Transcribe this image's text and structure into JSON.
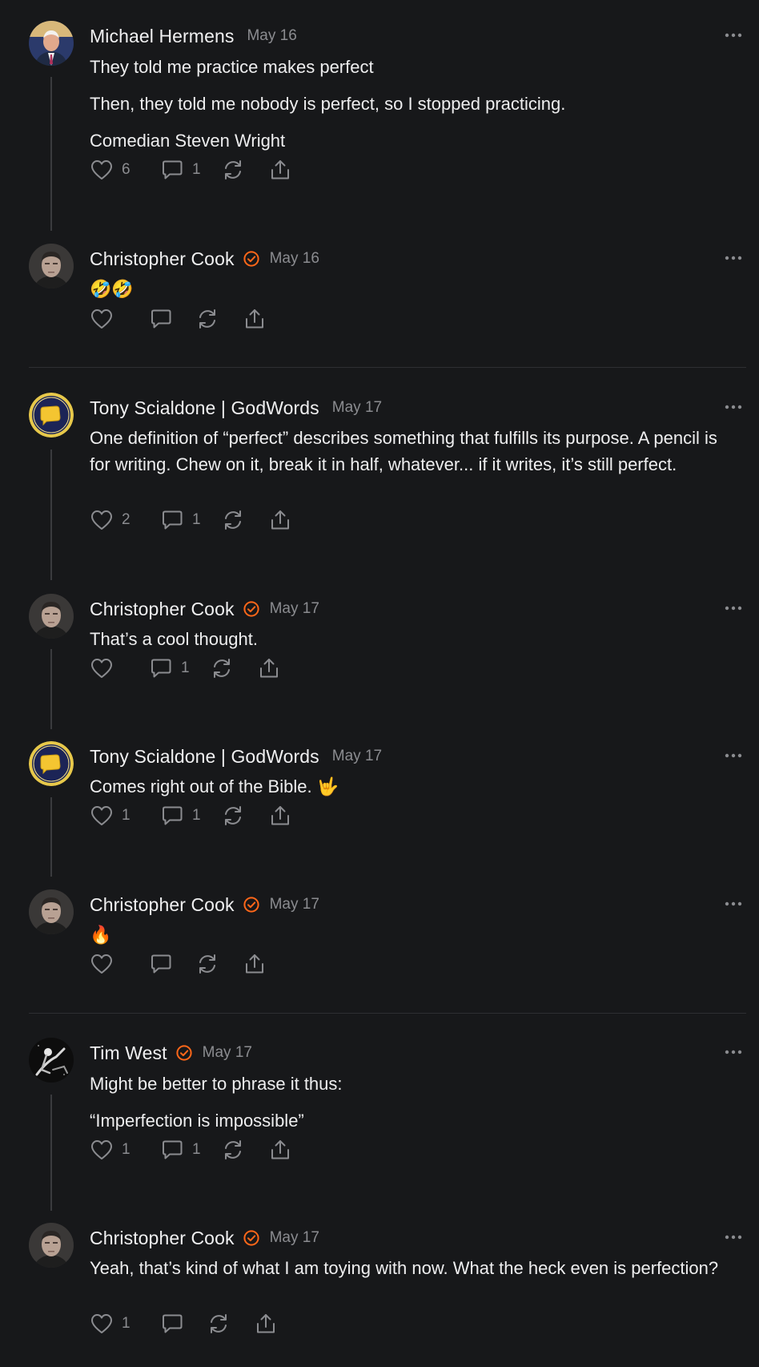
{
  "comments": [
    {
      "author": "Michael Hermens",
      "verified": false,
      "date": "May 16",
      "avatar": "avatar-michael-hermens",
      "paragraphs": [
        "They told me practice makes perfect",
        "Then, they told me nobody is perfect, so I stopped practicing.",
        "Comedian Steven Wright"
      ],
      "likes": "6",
      "replies": "1"
    },
    {
      "author": "Christopher Cook",
      "verified": true,
      "date": "May 16",
      "avatar": "avatar-christopher-cook",
      "paragraphs": [
        "🤣🤣"
      ],
      "likes": "",
      "replies": ""
    },
    {
      "author": "Tony Scialdone | GodWords",
      "verified": false,
      "date": "May 17",
      "avatar": "avatar-godwords",
      "paragraphs": [
        "One definition of “perfect” describes something that fulfills its purpose. A pencil is for writing. Chew on it, break it in half, whatever... if it writes, it’s still perfect."
      ],
      "likes": "2",
      "replies": "1"
    },
    {
      "author": "Christopher Cook",
      "verified": true,
      "date": "May 17",
      "avatar": "avatar-christopher-cook",
      "paragraphs": [
        "That’s a cool thought."
      ],
      "likes": "",
      "replies": "1"
    },
    {
      "author": "Tony Scialdone | GodWords",
      "verified": false,
      "date": "May 17",
      "avatar": "avatar-godwords",
      "paragraphs": [
        "Comes right out of the Bible. 🤟"
      ],
      "likes": "1",
      "replies": "1"
    },
    {
      "author": "Christopher Cook",
      "verified": true,
      "date": "May 17",
      "avatar": "avatar-christopher-cook",
      "paragraphs": [
        "🔥"
      ],
      "likes": "",
      "replies": ""
    },
    {
      "author": "Tim West",
      "verified": true,
      "date": "May 17",
      "avatar": "avatar-tim-west",
      "paragraphs": [
        "Might be better to phrase it thus:",
        "“Imperfection is impossible”"
      ],
      "likes": "1",
      "replies": "1"
    },
    {
      "author": "Christopher Cook",
      "verified": true,
      "date": "May 17",
      "avatar": "avatar-christopher-cook",
      "paragraphs": [
        "Yeah, that’s kind of what I am toying with now. What the heck even is perfection?"
      ],
      "likes": "1",
      "replies": ""
    }
  ],
  "icons": {
    "like": "heart-icon",
    "reply": "comment-bubble-icon",
    "restack": "restack-icon",
    "share": "share-icon",
    "more": "more-options-icon",
    "verified": "verified-badge-icon"
  },
  "colors": {
    "background": "#17181a",
    "text": "#eeeeef",
    "muted": "#8b8c90",
    "verified": "#ff6719",
    "thread_line": "#3a3b3e"
  }
}
